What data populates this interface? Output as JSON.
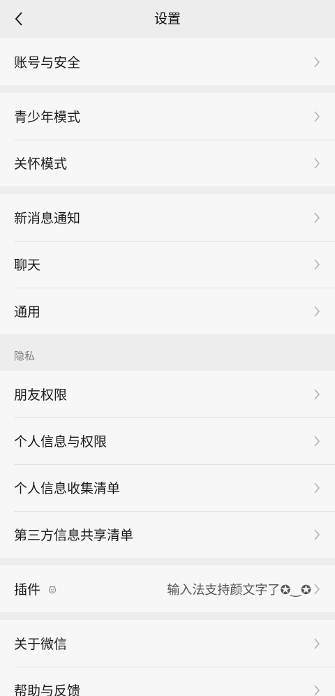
{
  "header": {
    "title": "设置"
  },
  "groups": {
    "account": {
      "items": [
        "账号与安全"
      ]
    },
    "mode": {
      "items": [
        "青少年模式",
        "关怀模式"
      ]
    },
    "general": {
      "items": [
        "新消息通知",
        "聊天",
        "通用"
      ]
    },
    "privacy": {
      "section_label": "隐私",
      "items": [
        "朋友权限",
        "个人信息与权限",
        "个人信息收集清单",
        "第三方信息共享清单"
      ]
    },
    "plugins": {
      "label": "插件",
      "value": "输入法支持颜文字了✪‿✪"
    },
    "about": {
      "items": [
        "关于微信",
        "帮助与反馈"
      ]
    }
  },
  "colors": {
    "background": "#ededed",
    "cell": "#f7f7f7",
    "text": "#1a1a1a",
    "secondary": "#7f7f7f",
    "chevron": "#b2b2b2"
  },
  "icons": {
    "back": "chevron-left-icon",
    "row_arrow": "chevron-right-icon",
    "plugin": "plugin-icon"
  }
}
